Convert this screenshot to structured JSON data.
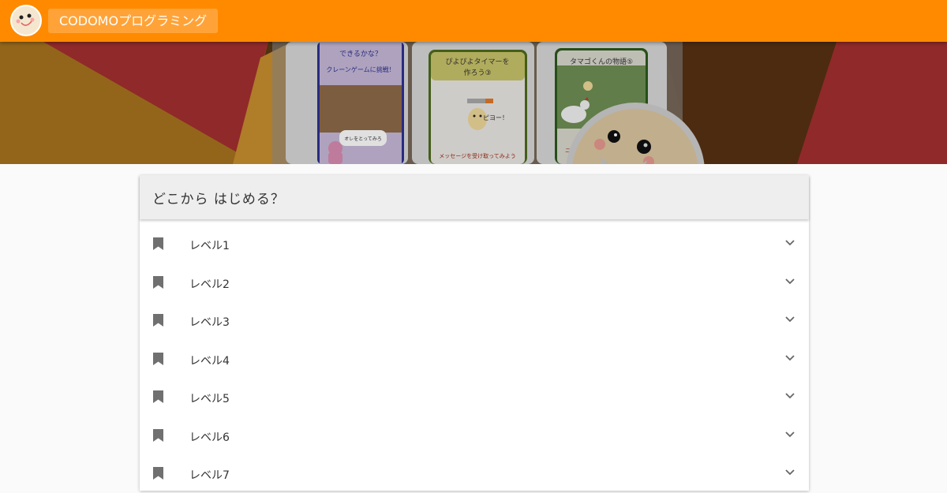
{
  "appbar": {
    "brand_label": "CODOMOプログラミング",
    "bg_color": "#ff8a00",
    "logo_icon": "smiling-face-logo-icon"
  },
  "hero": {
    "cards": [
      {
        "line1": "できるかな？",
        "line2": "クレーンゲームに挑戦！",
        "bubble": "オレをとってみろ"
      },
      {
        "line1": "ぴよぴよタイマーを",
        "line2": "作ろう③",
        "bubble": "ピヨー！",
        "footer": "メッセージを受け取ってみよう"
      },
      {
        "line1": "タマゴくんの物語⑤",
        "footer": "ニワト"
      }
    ]
  },
  "main": {
    "title": "どこから はじめる？",
    "levels": [
      {
        "label": "レベル1"
      },
      {
        "label": "レベル2"
      },
      {
        "label": "レベル3"
      },
      {
        "label": "レベル4"
      },
      {
        "label": "レベル5"
      },
      {
        "label": "レベル6"
      },
      {
        "label": "レベル7"
      }
    ]
  }
}
